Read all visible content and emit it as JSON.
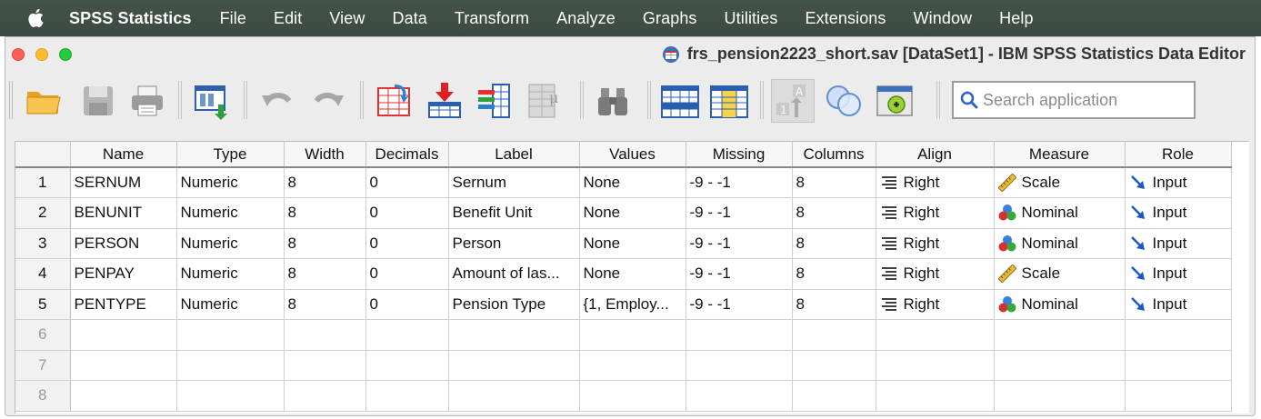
{
  "menubar": {
    "app": "SPSS Statistics",
    "items": [
      "File",
      "Edit",
      "View",
      "Data",
      "Transform",
      "Analyze",
      "Graphs",
      "Utilities",
      "Extensions",
      "Window",
      "Help"
    ]
  },
  "window": {
    "title": "frs_pension2223_short.sav [DataSet1] - IBM SPSS Statistics Data Editor"
  },
  "toolbar": {
    "search_placeholder": "Search application"
  },
  "table": {
    "headers": [
      "Name",
      "Type",
      "Width",
      "Decimals",
      "Label",
      "Values",
      "Missing",
      "Columns",
      "Align",
      "Measure",
      "Role"
    ],
    "rows": [
      {
        "num": "1",
        "name": "SERNUM",
        "type": "Numeric",
        "width": "8",
        "decimals": "0",
        "label": "Sernum",
        "values": "None",
        "missing": "-9 - -1",
        "columns": "8",
        "align": "Right",
        "measure": "Scale",
        "role": "Input"
      },
      {
        "num": "2",
        "name": "BENUNIT",
        "type": "Numeric",
        "width": "8",
        "decimals": "0",
        "label": "Benefit Unit",
        "values": "None",
        "missing": "-9 - -1",
        "columns": "8",
        "align": "Right",
        "measure": "Nominal",
        "role": "Input"
      },
      {
        "num": "3",
        "name": "PERSON",
        "type": "Numeric",
        "width": "8",
        "decimals": "0",
        "label": "Person",
        "values": "None",
        "missing": "-9 - -1",
        "columns": "8",
        "align": "Right",
        "measure": "Nominal",
        "role": "Input"
      },
      {
        "num": "4",
        "name": "PENPAY",
        "type": "Numeric",
        "width": "8",
        "decimals": "0",
        "label": "Amount of las...",
        "values": "None",
        "missing": "-9 - -1",
        "columns": "8",
        "align": "Right",
        "measure": "Scale",
        "role": "Input"
      },
      {
        "num": "5",
        "name": "PENTYPE",
        "type": "Numeric",
        "width": "8",
        "decimals": "0",
        "label": "Pension Type",
        "values": "{1, Employ...",
        "missing": "-9 - -1",
        "columns": "8",
        "align": "Right",
        "measure": "Nominal",
        "role": "Input"
      }
    ],
    "empty_rows": [
      "6",
      "7",
      "8"
    ]
  },
  "icons": {
    "align": "align-right-icon",
    "scale": "ruler-icon",
    "nominal": "nominal-circles-icon",
    "role": "input-arrow-icon"
  }
}
